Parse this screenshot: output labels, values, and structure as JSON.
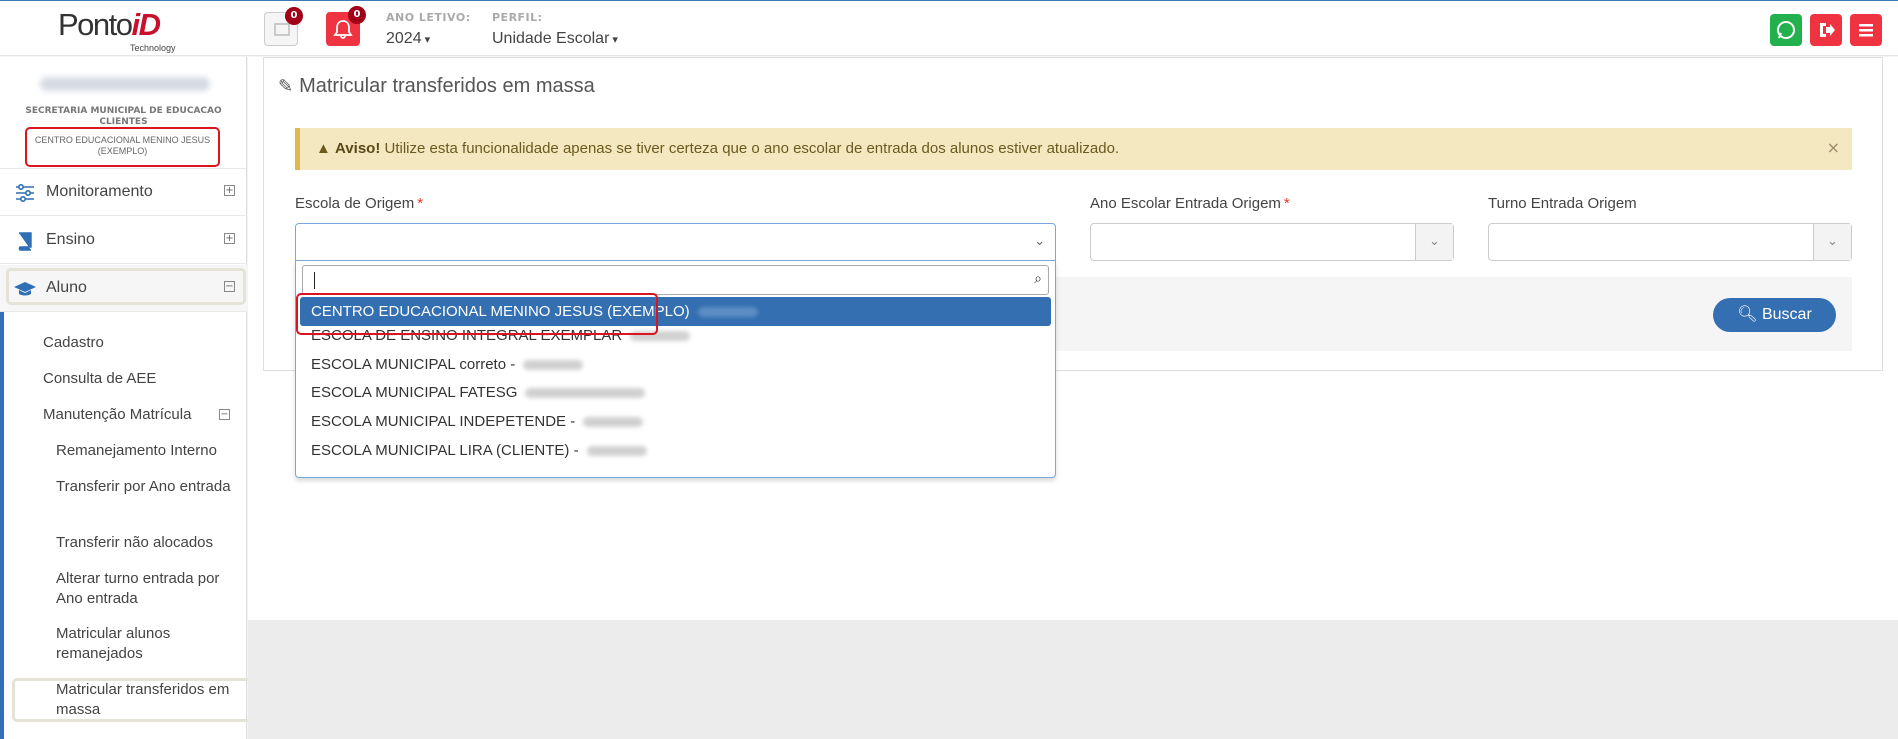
{
  "brand": {
    "name_part1": "Ponto",
    "name_part2": "iD",
    "tagline": "Technology"
  },
  "header": {
    "messages_count": "0",
    "notifications_count": "0",
    "ano_letivo_label": "ANO LETIVO:",
    "ano_letivo_value": "2024",
    "perfil_label": "PERFIL:",
    "perfil_value": "Unidade Escolar",
    "icons": [
      "messages-icon",
      "bell-icon",
      "whatsapp-icon",
      "logout-icon",
      "menu-icon"
    ]
  },
  "sidebar": {
    "org_name": "SECRETARIA MUNICIPAL DE EDUCACAO CLIENTES",
    "school_name": "CENTRO EDUCACIONAL MENINO JESUS (EXEMPLO)",
    "menu": [
      {
        "label": "Monitoramento",
        "icon": "sliders-icon",
        "toggle": "+"
      },
      {
        "label": "Ensino",
        "icon": "book-icon",
        "toggle": "+"
      },
      {
        "label": "Aluno",
        "icon": "graduation-cap-icon",
        "toggle": "−"
      }
    ],
    "aluno_items": [
      "Cadastro",
      "Consulta de AEE",
      "Manutenção Matrícula"
    ],
    "manutencao_toggle": "−",
    "manutencao_items": [
      "Remanejamento Interno",
      "Transferir por Ano entrada",
      "Transferir não alocados",
      "Alterar turno entrada por Ano entrada",
      "Matricular alunos remanejados",
      "Matricular transferidos em massa"
    ]
  },
  "main": {
    "title": "Matricular transferidos em massa",
    "alert_strong": "Aviso!",
    "alert_text": "Utilize esta funcionalidade apenas se tiver certeza que o ano escolar de entrada dos alunos estiver atualizado.",
    "alert_close": "×",
    "fields": {
      "escola_label": "Escola de Origem",
      "ano_label": "Ano Escolar Entrada Origem",
      "turno_label": "Turno Entrada Origem",
      "required_mark": "*"
    },
    "buscar_label": "Buscar"
  },
  "dropdown": {
    "search_value": "",
    "options": [
      "CENTRO EDUCACIONAL MENINO JESUS (EXEMPLO)",
      "ESCOLA DE ENSINO INTEGRAL EXEMPLAR",
      "ESCOLA MUNICIPAL correto -",
      "ESCOLA MUNICIPAL FATESG",
      "ESCOLA MUNICIPAL INDEPETENDE -",
      "ESCOLA MUNICIPAL LIRA (CLIENTE) -"
    ],
    "selected_index": 0
  },
  "colors": {
    "primary": "#336fb1",
    "danger": "#ef3340",
    "whatsapp": "#23b14d",
    "alert_bg": "#f4e8c1",
    "highlight_box": "#d9161f"
  }
}
